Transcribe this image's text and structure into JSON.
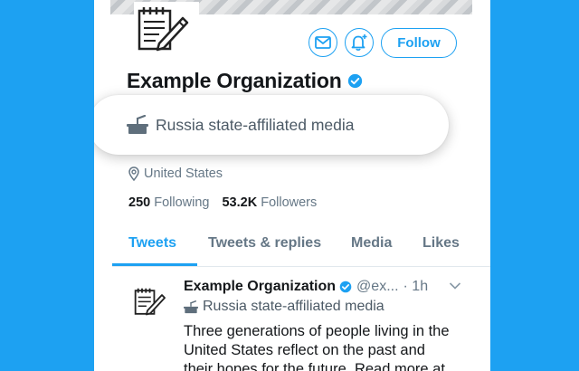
{
  "profile": {
    "name": "Example Organization",
    "label": "Russia state-affiliated media",
    "location": "United States",
    "following_count": "250",
    "following_label": "Following",
    "followers_count": "53.2K",
    "followers_label": "Followers",
    "follow_label": "Follow"
  },
  "tabs": [
    "Tweets",
    "Tweets & replies",
    "Media",
    "Likes"
  ],
  "tweet": {
    "name": "Example Organization",
    "handle": "@ex...",
    "time": "· 1h",
    "label": "Russia state-affiliated media",
    "text": "Three generations of people living in the United States reflect on the past and their hopes for the future. Read more at"
  },
  "icons": {
    "avatar": "notepad-pen-icon",
    "message": "envelope-icon",
    "notify": "bell-plus-icon",
    "verified": "verified-badge-icon",
    "state_media": "podium-icon",
    "location": "location-pin-icon",
    "more": "chevron-down-icon"
  },
  "colors": {
    "accent": "#1da1f2",
    "background": "#1da1f2",
    "text": "#14171a",
    "muted": "#657786"
  }
}
